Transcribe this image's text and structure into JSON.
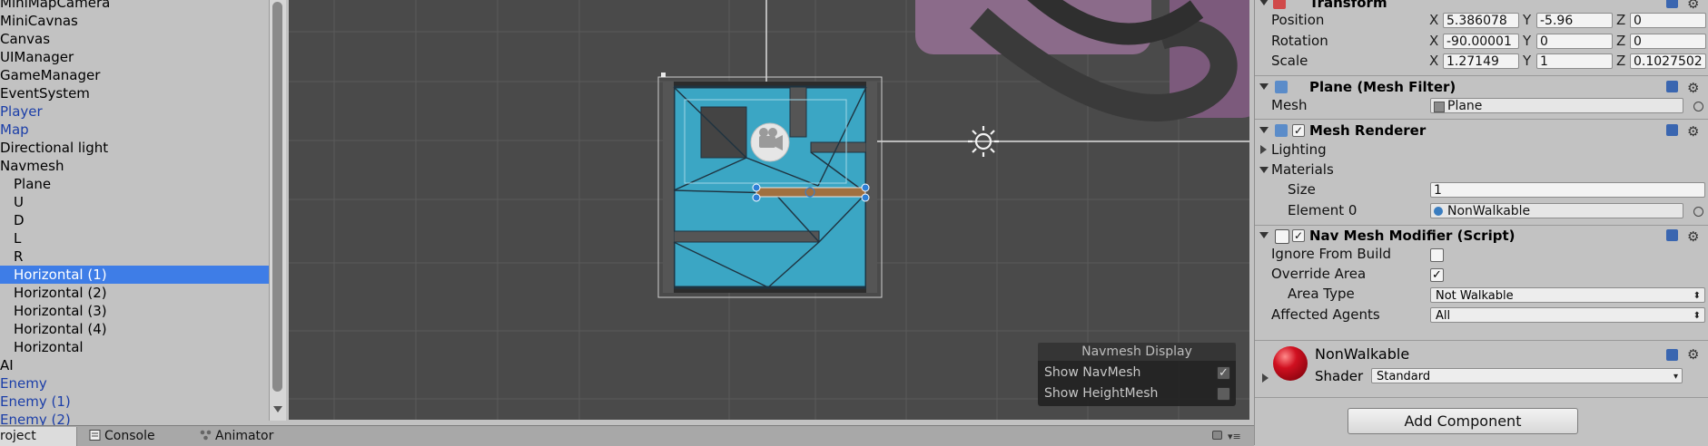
{
  "hierarchy": {
    "items": [
      {
        "label": "MiniMapCamera",
        "indent": false,
        "style": ""
      },
      {
        "label": "MiniCavnas",
        "indent": false,
        "style": ""
      },
      {
        "label": "Canvas",
        "indent": false,
        "style": ""
      },
      {
        "label": "UIManager",
        "indent": false,
        "style": ""
      },
      {
        "label": "GameManager",
        "indent": false,
        "style": ""
      },
      {
        "label": "EventSystem",
        "indent": false,
        "style": ""
      },
      {
        "label": "Player",
        "indent": false,
        "style": "blue"
      },
      {
        "label": "Map",
        "indent": false,
        "style": "blue"
      },
      {
        "label": "Directional light",
        "indent": false,
        "style": ""
      },
      {
        "label": "Navmesh",
        "indent": false,
        "style": ""
      },
      {
        "label": "Plane",
        "indent": true,
        "style": ""
      },
      {
        "label": "U",
        "indent": true,
        "style": ""
      },
      {
        "label": "D",
        "indent": true,
        "style": ""
      },
      {
        "label": "L",
        "indent": true,
        "style": ""
      },
      {
        "label": "R",
        "indent": true,
        "style": ""
      },
      {
        "label": "Horizontal (1)",
        "indent": true,
        "style": "sel"
      },
      {
        "label": "Horizontal (2)",
        "indent": true,
        "style": ""
      },
      {
        "label": "Horizontal (3)",
        "indent": true,
        "style": ""
      },
      {
        "label": "Horizontal (4)",
        "indent": true,
        "style": ""
      },
      {
        "label": "Horizontal",
        "indent": true,
        "style": ""
      },
      {
        "label": "AI",
        "indent": false,
        "style": ""
      },
      {
        "label": "Enemy",
        "indent": false,
        "style": "blue"
      },
      {
        "label": "Enemy (1)",
        "indent": false,
        "style": "blue"
      },
      {
        "label": "Enemy (2)",
        "indent": false,
        "style": "blue"
      }
    ]
  },
  "tabs": {
    "project": "roject",
    "console": "Console",
    "animator": "Animator"
  },
  "navmesh_display": {
    "title": "Navmesh Display",
    "show_navmesh": "Show NavMesh",
    "show_navmesh_checked": true,
    "show_heightmesh": "Show HeightMesh",
    "show_heightmesh_checked": false
  },
  "inspector": {
    "transform": {
      "title": "Transform",
      "position_label": "Position",
      "rotation_label": "Rotation",
      "scale_label": "Scale",
      "x": "X",
      "y": "Y",
      "z": "Z",
      "position": {
        "x": "5.386078",
        "y": "-5.96",
        "z": "0"
      },
      "rotation": {
        "x": "-90.00001",
        "y": "0",
        "z": "0"
      },
      "scale": {
        "x": "1.27149",
        "y": "1",
        "z": "0.1027502"
      }
    },
    "mesh_filter": {
      "title": "Plane (Mesh Filter)",
      "mesh_label": "Mesh",
      "mesh_value": "Plane"
    },
    "mesh_renderer": {
      "title": "Mesh Renderer",
      "enabled": true,
      "lighting": "Lighting",
      "materials": "Materials",
      "size_label": "Size",
      "size_value": "1",
      "element0_label": "Element 0",
      "element0_value": "NonWalkable"
    },
    "nav_mesh_modifier": {
      "title": "Nav Mesh Modifier (Script)",
      "enabled": true,
      "ignore_label": "Ignore From Build",
      "ignore_checked": false,
      "override_label": "Override Area",
      "override_checked": true,
      "area_type_label": "Area Type",
      "area_type_value": "Not Walkable",
      "affected_label": "Affected Agents",
      "affected_value": "All"
    },
    "material": {
      "name": "NonWalkable",
      "shader_label": "Shader",
      "shader_value": "Standard",
      "color": "#c0101a"
    },
    "add_component": "Add Component"
  },
  "colors": {
    "selection": "#3e7de7",
    "scene_bg": "#4a4a4a",
    "navmesh": "#3aa8c8"
  }
}
